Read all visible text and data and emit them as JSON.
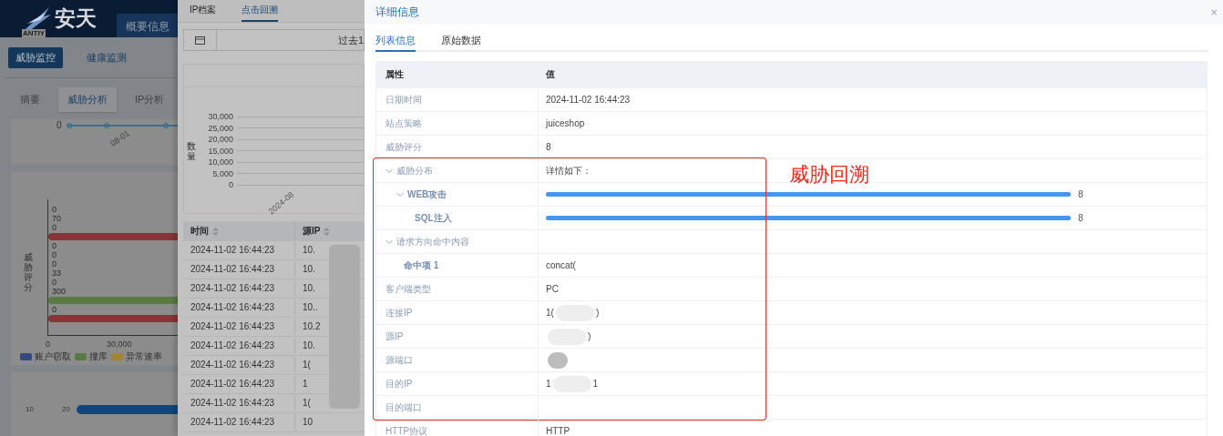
{
  "app": {
    "logo_text": "安天",
    "logo_sub": "ANTIY",
    "header_tab": "概要信息",
    "nav": [
      {
        "label": "威胁监控",
        "selected": true
      },
      {
        "label": "健康监测",
        "selected": false
      }
    ],
    "subtabs": [
      {
        "label": "摘要",
        "selected": false
      },
      {
        "label": "威胁分析",
        "selected": true
      },
      {
        "label": "IP分析",
        "selected": false
      }
    ],
    "trend_card": {
      "y_tick": "0",
      "x_tick": "08-01"
    },
    "score_card": {
      "ylabel": "威胁评分",
      "x_ticks": [
        "0",
        "30,000"
      ],
      "items": [
        {
          "kind": "label",
          "text": "0"
        },
        {
          "kind": "label",
          "text": "70"
        },
        {
          "kind": "label",
          "text": "0"
        },
        {
          "kind": "bar",
          "color": "#8a3436"
        },
        {
          "kind": "label",
          "text": "0"
        },
        {
          "kind": "label",
          "text": "0"
        },
        {
          "kind": "label",
          "text": "0"
        },
        {
          "kind": "label",
          "text": "33"
        },
        {
          "kind": "label",
          "text": "0"
        },
        {
          "kind": "label",
          "text": "300"
        },
        {
          "kind": "bar",
          "color": "#5a7a44"
        },
        {
          "kind": "label",
          "text": "0"
        },
        {
          "kind": "bar",
          "color": "#8a3436"
        }
      ],
      "legend": [
        {
          "label": "账户窃取",
          "color": "#34477f"
        },
        {
          "label": "撞库",
          "color": "#5a7a44"
        },
        {
          "label": "异常速率",
          "color": "#9f8535"
        }
      ]
    },
    "third_card": {
      "labels": [
        "10",
        "20"
      ]
    }
  },
  "drawer": {
    "tabs": [
      {
        "label": "IP档案",
        "selected": false
      },
      {
        "label": "点击回溯",
        "selected": true
      }
    ],
    "date_range": "过去1",
    "chart": {
      "ylabel": "数量",
      "yticks": [
        "30,000",
        "25,000",
        "20,000",
        "15,000",
        "10,000",
        "5,000",
        "0"
      ],
      "xtick": "2024-08"
    },
    "table": {
      "columns": [
        "时间",
        "源IP"
      ],
      "rows": [
        [
          "2024-11-02 16:44:23",
          "10."
        ],
        [
          "2024-11-02 16:44:23",
          "10."
        ],
        [
          "2024-11-02 16:44:23",
          "10."
        ],
        [
          "2024-11-02 16:44:23",
          "10.."
        ],
        [
          "2024-11-02 16:44:23",
          "10.2"
        ],
        [
          "2024-11-02 16:44:23",
          "10."
        ],
        [
          "2024-11-02 16:44:23",
          "1("
        ],
        [
          "2024-11-02 16:44:23",
          "1"
        ],
        [
          "2024-11-02 16:44:23",
          "1("
        ],
        [
          "2024-11-02 16:44:23",
          "10"
        ]
      ]
    }
  },
  "detail": {
    "title": "详细信息",
    "close": "×",
    "tabs": [
      {
        "label": "列表信息",
        "selected": true
      },
      {
        "label": "原始数据",
        "selected": false
      }
    ],
    "columns": [
      "属性",
      "值"
    ],
    "rows": [
      {
        "label": "日期时间",
        "value": "2024-11-02 16:44:23",
        "annotated": false
      },
      {
        "label": "站点策略",
        "value": "juiceshop",
        "annotated": false
      },
      {
        "label": "威胁评分",
        "value": "8",
        "annotated": false
      },
      {
        "label": "威胁分布",
        "value": "详情如下：",
        "expanded": true,
        "annotated": true,
        "children": [
          {
            "label": "WEB攻击",
            "kind": "bar",
            "level": 1,
            "reading": "8",
            "expanded": true,
            "annotated": true,
            "children": [
              {
                "label": "SQL注入",
                "kind": "bar",
                "level": 1,
                "reading": "8",
                "annotated": true
              }
            ]
          }
        ]
      },
      {
        "label": "请求方向命中内容",
        "expanded": true,
        "annotated": true,
        "children": [
          {
            "label": "命中项 1",
            "value": "concat(",
            "annotated": true
          }
        ]
      },
      {
        "label": "客户端类型",
        "value": "PC",
        "annotated": true
      },
      {
        "label": "连接IP",
        "value": "1(",
        "tail": ")",
        "redacted": true,
        "annotated": true
      },
      {
        "label": "源IP",
        "tail": ")",
        "redacted": true,
        "annotated": true
      },
      {
        "label": "源端口",
        "redacted": true,
        "annotated": true
      },
      {
        "label": "目的IP",
        "value": "1",
        "tail": "1",
        "redacted": true,
        "annotated": true
      },
      {
        "label": "目的端口",
        "annotated": true
      },
      {
        "label": "HTTP协议",
        "value": "HTTP",
        "annotated": false
      }
    ],
    "annotation": {
      "text": "威胁回溯"
    }
  }
}
